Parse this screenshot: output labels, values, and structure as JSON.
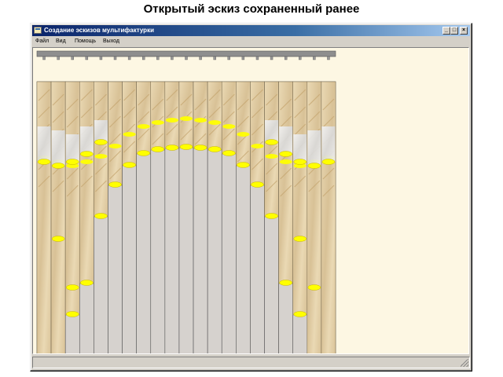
{
  "slide": {
    "heading": "Открытый эскиз сохраненный ранее"
  },
  "window": {
    "title": "Создание эскизов мультифактурки",
    "controls": {
      "minimize": "_",
      "maximize": "□",
      "close": "×"
    },
    "menu": [
      "Файл",
      "Вид",
      "Помощь",
      "Выход"
    ]
  },
  "design": {
    "slat_count": 21,
    "colors": {
      "canvas": "#fdf7e3",
      "plain_slat": "#d6d2ce",
      "fabric": "#d8c196",
      "fabric_light": "#ead9b4",
      "swag_white": "#d9d9d9",
      "trim": "#ffff00",
      "rail": "#8e8e8e"
    },
    "icons": [
      "app-icon",
      "minimize-icon",
      "maximize-icon",
      "close-icon",
      "size-grip-icon"
    ]
  }
}
